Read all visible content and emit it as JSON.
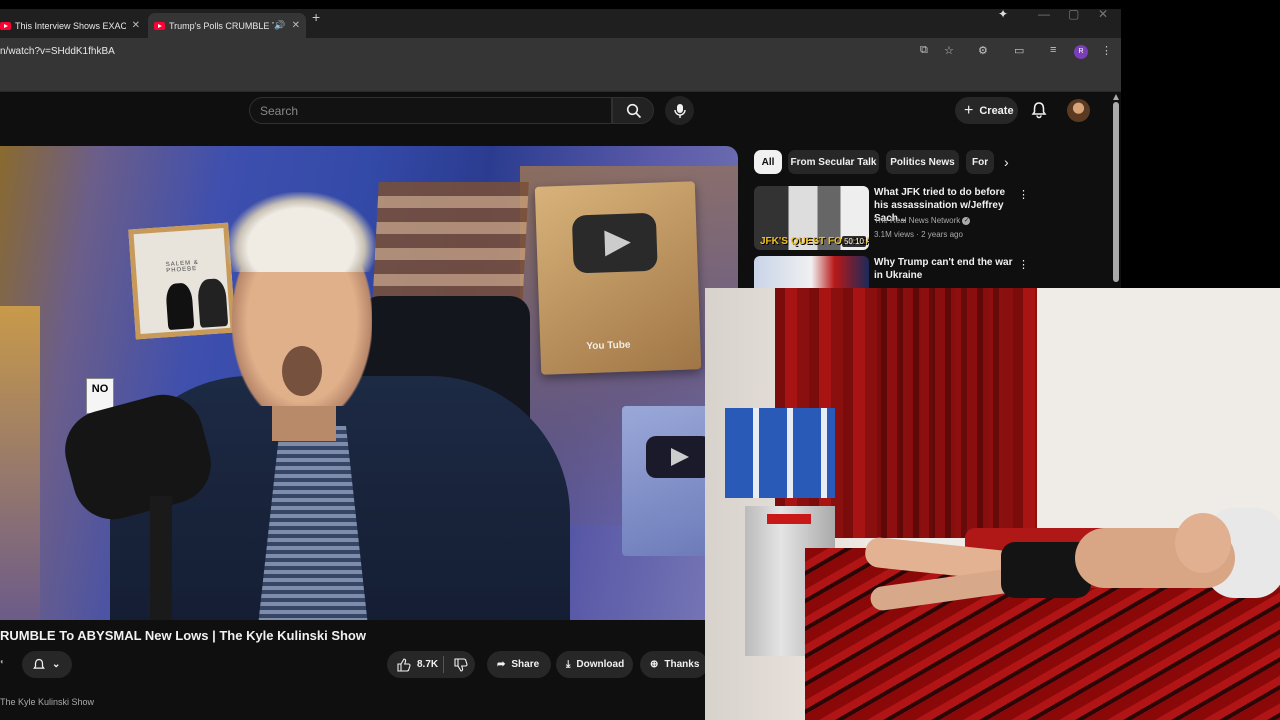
{
  "browser": {
    "tabs": [
      {
        "title": "This Interview Shows EXACTLY"
      },
      {
        "title": "Trump's Polls CRUMBLE To"
      }
    ],
    "url": "n/watch?v=SHddK1fhkBA",
    "profile_initial": "R"
  },
  "youtube": {
    "search_placeholder": "Search",
    "create_label": "Create",
    "video": {
      "title": "RUMBLE To ABYSMAL New Lows | The Kyle Kulinski Show",
      "channel": "The Kyle Kulinski Show",
      "likes": "8.7K",
      "share_label": "Share",
      "download_label": "Download",
      "thanks_label": "Thanks",
      "thumb_text_1": "SALEM & PHOEBE",
      "thumb_text_2": "NO",
      "thumb_text_3": "You Tube"
    },
    "chips": [
      "All",
      "From Secular Talk",
      "Politics News",
      "For"
    ],
    "recommendations": [
      {
        "title": "What JFK tried to do before his assassination w/Jeffrey Sach...",
        "channel": "The Real News Network",
        "meta": "3.1M views · 2 years ago",
        "thumb_caption": "JFK'S QUEST FOR PEACE",
        "duration": "50:10"
      },
      {
        "title": "Why Trump can't end the war in Ukraine",
        "channel": "",
        "meta": ""
      }
    ]
  },
  "icons": {
    "search": "magnifier",
    "mic": "microphone",
    "bell": "notification-bell",
    "like": "thumbs-up",
    "dislike": "thumbs-down"
  }
}
